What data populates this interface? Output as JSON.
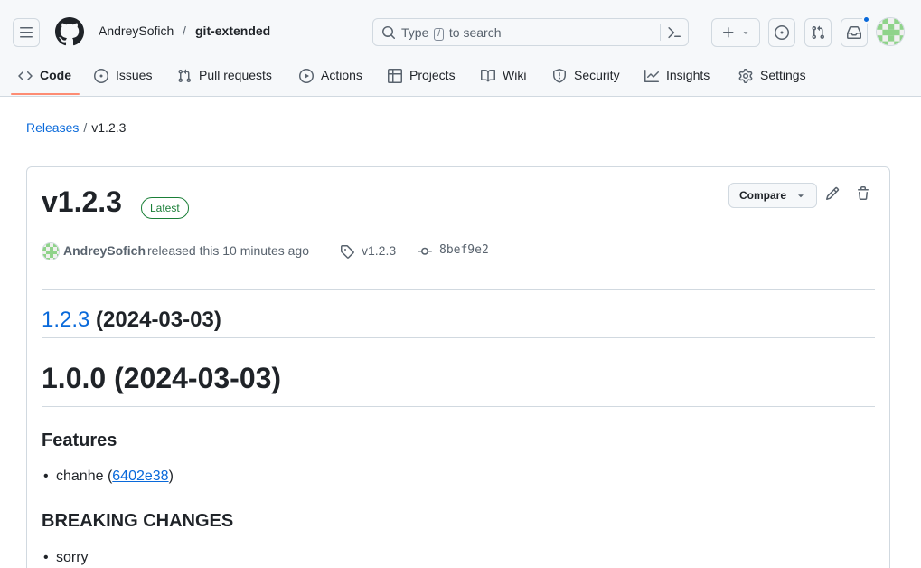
{
  "header": {
    "owner": "AndreySofich",
    "separator": "/",
    "repo": "git-extended",
    "search_placeholder_pre": "Type",
    "search_key": "/",
    "search_placeholder_post": "to search"
  },
  "tabs": [
    {
      "label": "Code",
      "icon": "code-icon"
    },
    {
      "label": "Issues",
      "icon": "issue-opened-icon"
    },
    {
      "label": "Pull requests",
      "icon": "git-pull-request-icon"
    },
    {
      "label": "Actions",
      "icon": "play-icon"
    },
    {
      "label": "Projects",
      "icon": "table-icon"
    },
    {
      "label": "Wiki",
      "icon": "book-icon"
    },
    {
      "label": "Security",
      "icon": "shield-icon"
    },
    {
      "label": "Insights",
      "icon": "graph-icon"
    },
    {
      "label": "Settings",
      "icon": "gear-icon"
    }
  ],
  "breadcrumb": {
    "releases": "Releases",
    "sep": "/",
    "current": "v1.2.3"
  },
  "release": {
    "title": "v1.2.3",
    "badge": "Latest",
    "compare_label": "Compare",
    "author": "AndreySofich",
    "released_text": "released this 10 minutes ago",
    "tag": "v1.2.3",
    "commit": "8bef9e2"
  },
  "notes": {
    "h2_link": "1.2.3",
    "h2_rest": " (2024-03-03)",
    "h1": "1.0.0 (2024-03-03)",
    "features_heading": "Features",
    "feature_text": "chanhe (",
    "feature_link": "6402e38",
    "feature_close": ")",
    "breaking_heading": "BREAKING CHANGES",
    "breaking_item": "sorry"
  },
  "colors": {
    "accent": "#0969da",
    "latest_badge": "#1a7f37",
    "tab_underline": "#fd8c73",
    "notification_dot": "#0969da"
  }
}
